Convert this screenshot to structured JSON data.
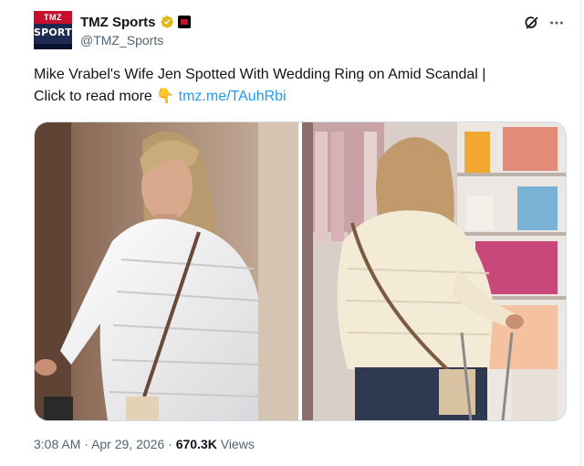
{
  "author": {
    "display_name": "TMZ Sports",
    "handle": "@TMZ_Sports",
    "avatar_label": "SPORTS",
    "verified_icon": "gold-check-icon",
    "affiliate_icon": "tmz-affiliate-icon"
  },
  "post": {
    "text_line1": "Mike Vrabel's Wife Jen Spotted With Wedding Ring on Amid Scandal  |",
    "text_line2_prefix": "Click to read more",
    "emoji": "👇",
    "link": "tmz.me/TAuhRbi"
  },
  "meta": {
    "time": "3:08 AM",
    "separator": "·",
    "date": "Apr 29, 2026",
    "views_count": "670.3K",
    "views_label": "Views"
  },
  "colors": {
    "link": "#1d9bf0",
    "secondary_text": "#536471",
    "verified_gold": "#e2b719"
  },
  "icons": {
    "grok": "grok-icon",
    "more": "more-options-icon"
  }
}
